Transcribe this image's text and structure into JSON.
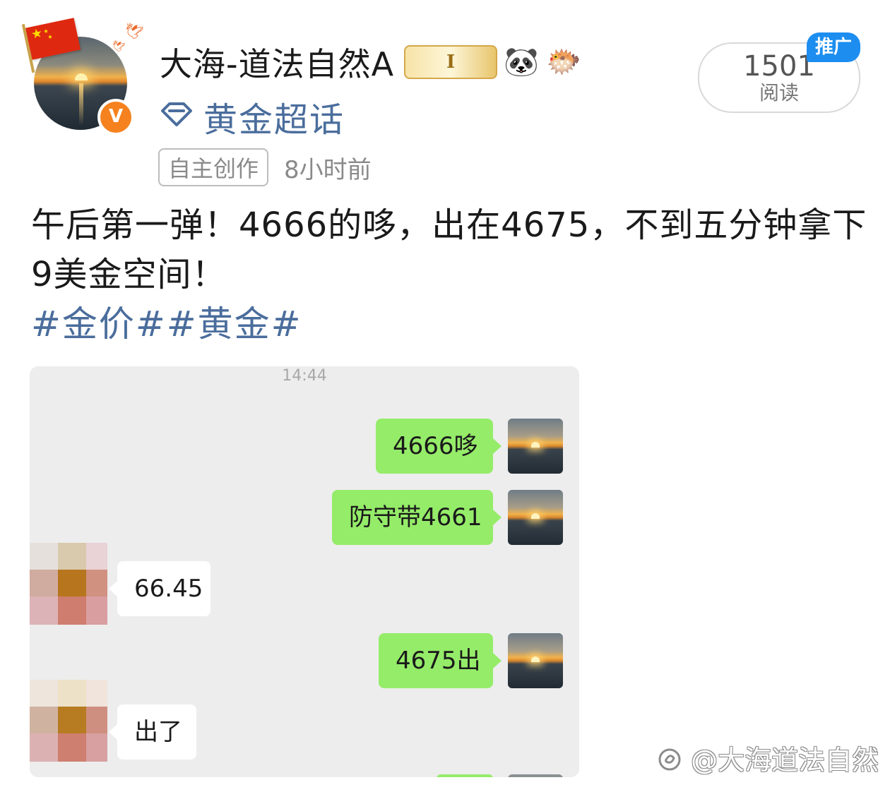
{
  "author": {
    "name": "大海-道法自然A",
    "verified_mark": "V",
    "level_badge": "I",
    "emoji_badges": [
      "🐼",
      "🐡"
    ]
  },
  "topic": {
    "name": "黄金超话"
  },
  "meta": {
    "tag": "自主创作",
    "time": "8小时前"
  },
  "reads": {
    "count": "1501",
    "label": "阅读",
    "promo": "推广"
  },
  "post": {
    "text": "午后第一弹！4666的哆，出在4675，不到五分钟拿下9美金空间！",
    "hashtags": "#金价##黄金#"
  },
  "chat": {
    "time": "14:44",
    "messages": [
      {
        "side": "me",
        "text": "4666哆"
      },
      {
        "side": "me",
        "text": "防守带4661"
      },
      {
        "side": "other",
        "text": "66.45"
      },
      {
        "side": "me",
        "text": "4675出"
      },
      {
        "side": "other",
        "text": "出了"
      }
    ]
  },
  "watermark": "@大海道法自然",
  "colors": {
    "link_blue": "#4a6d9c",
    "bubble_green": "#95ec69",
    "chat_bg": "#ededed",
    "verified_orange": "#f5821f",
    "promo_blue": "#1d8ef0"
  },
  "icons": {
    "topic": "diamond-icon",
    "flag": "china-flag-icon",
    "watermark": "weibo-logo-icon"
  }
}
